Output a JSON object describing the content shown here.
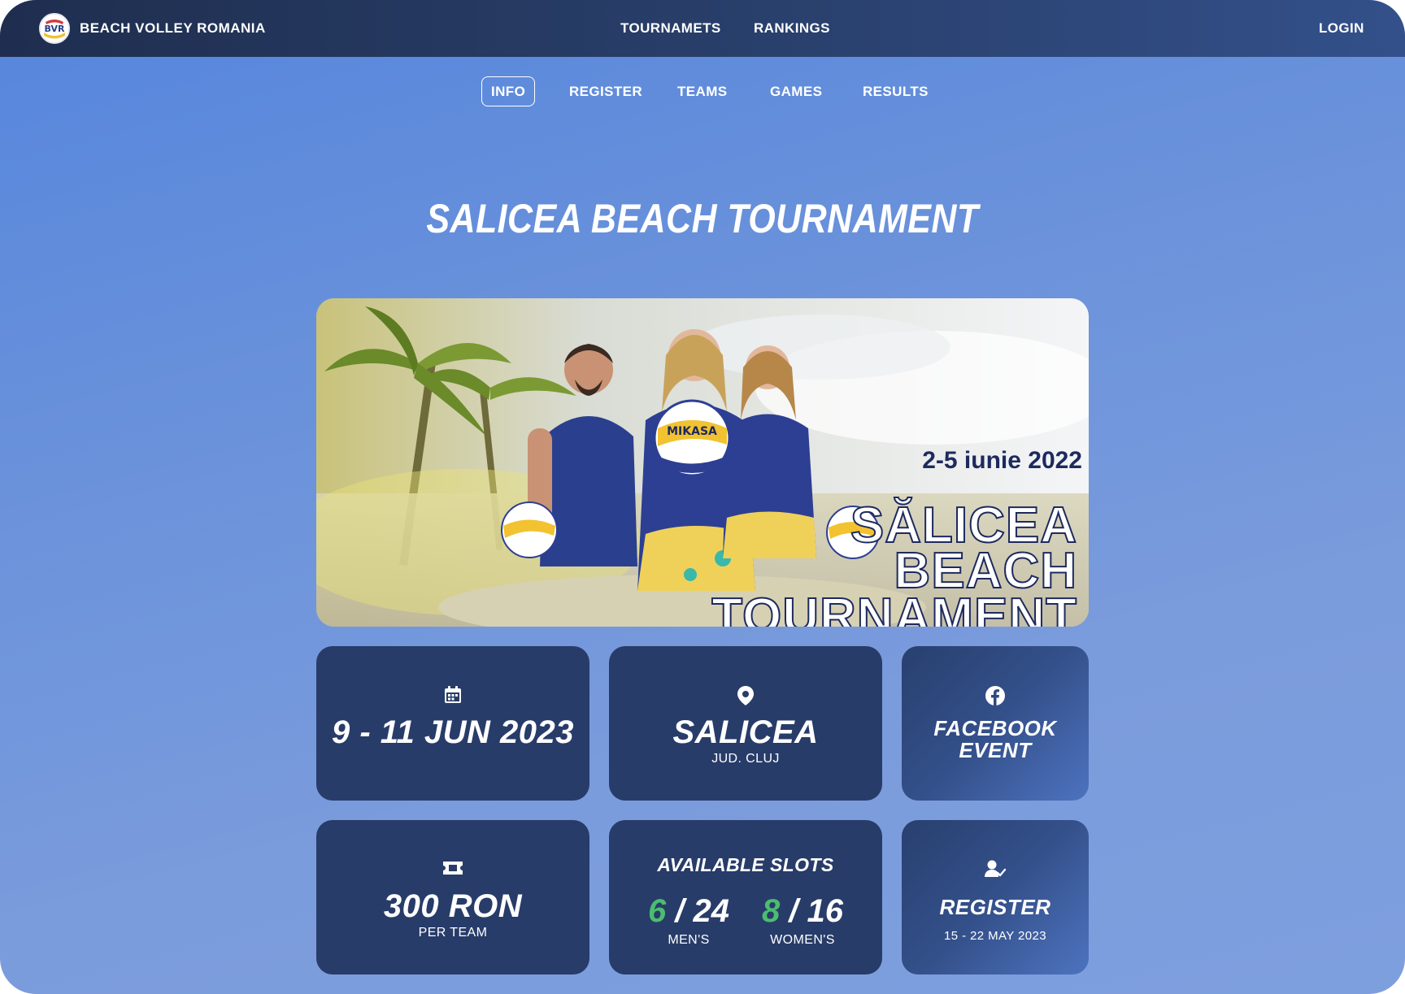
{
  "header": {
    "brand_name": "BEACH VOLLEY ROMANIA",
    "logo_text": "BVR",
    "nav": {
      "tournaments": "TOURNAMETS",
      "rankings": "RANKINGS"
    },
    "login": "LOGIN"
  },
  "tabs": [
    {
      "label": "INFO",
      "active": true
    },
    {
      "label": "REGISTER"
    },
    {
      "label": "TEAMS"
    },
    {
      "label": "GAMES"
    },
    {
      "label": "RESULTS"
    }
  ],
  "page_title": "SALICEA BEACH TOURNAMENT",
  "hero": {
    "date_text": "2-5 iunie 2022",
    "title_lines": [
      "SĂLICEA",
      "BEACH",
      "TOURNAMENT"
    ],
    "ball_brand": "MIKASA"
  },
  "cards": {
    "date": {
      "icon": "calendar-icon",
      "value": "9 - 11 JUN 2023"
    },
    "location": {
      "icon": "map-pin-icon",
      "value": "SALICEA",
      "sub": "JUD. CLUJ"
    },
    "facebook": {
      "icon": "facebook-icon",
      "line1": "FACEBOOK",
      "line2": "EVENT"
    },
    "fee": {
      "icon": "ticket-icon",
      "value": "300 RON",
      "sub": "PER TEAM"
    },
    "slots": {
      "title": "AVAILABLE SLOTS",
      "mens": {
        "filled": "6",
        "total": "/ 24",
        "label": "MEN'S"
      },
      "womens": {
        "filled": "8",
        "total": "/ 16",
        "label": "WOMEN'S"
      }
    },
    "register": {
      "icon": "user-check-icon",
      "value": "REGISTER",
      "sub": "15 - 22 MAY 2023"
    }
  },
  "colors": {
    "nav_dark": "#1f2e4f",
    "card": "#283c69",
    "page_bg": "#6790db",
    "slot_green": "#4cbc70"
  }
}
